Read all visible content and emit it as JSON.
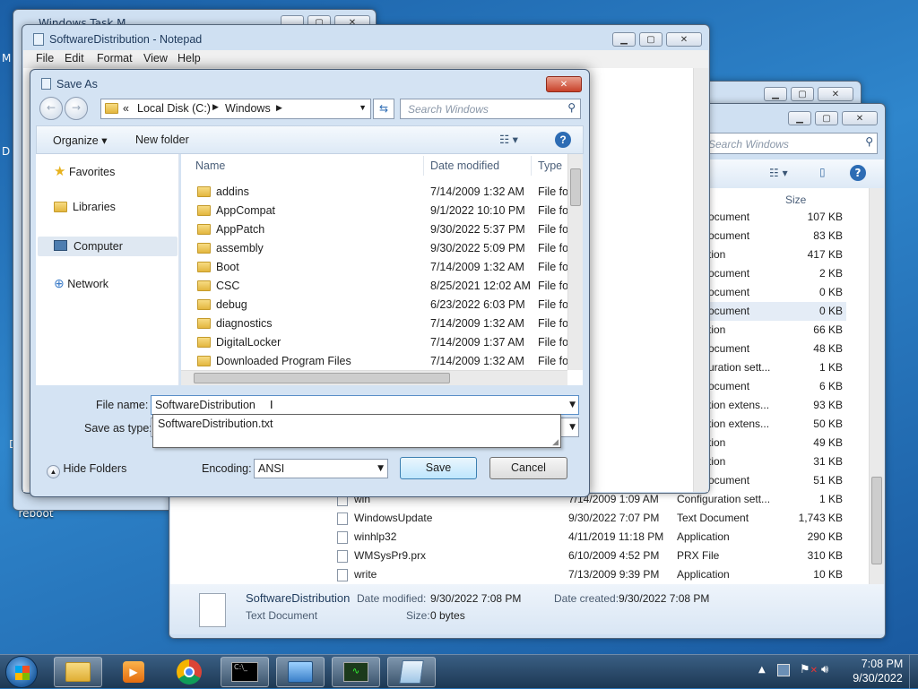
{
  "desktop": {
    "icons": [
      {
        "label": "reboot"
      }
    ],
    "edge_fragments": [
      "M",
      "D",
      "P",
      "N",
      "Do"
    ]
  },
  "bg_window_top": {
    "title": "Windows Task M"
  },
  "explorer": {
    "search_placeholder": "Search Windows",
    "columns": {
      "size": "Size"
    },
    "rows": [
      {
        "type": "ocument",
        "size": "107 KB"
      },
      {
        "type": "ocument",
        "size": "83 KB"
      },
      {
        "type": "tion",
        "size": "417 KB"
      },
      {
        "type": "ocument",
        "size": "2 KB"
      },
      {
        "type": "ocument",
        "size": "0 KB"
      },
      {
        "type": "ocument",
        "size": "0 KB"
      },
      {
        "type": "tion",
        "size": "66 KB"
      },
      {
        "type": "ocument",
        "size": "48 KB"
      },
      {
        "type": "uration sett...",
        "size": "1 KB"
      },
      {
        "type": "ocument",
        "size": "6 KB"
      },
      {
        "type": "tion extens...",
        "size": "93 KB"
      },
      {
        "type": "tion extens...",
        "size": "50 KB"
      },
      {
        "type": "tion",
        "size": "49 KB"
      },
      {
        "type": "tion",
        "size": "31 KB"
      },
      {
        "type": "ocument",
        "size": "51 KB"
      }
    ],
    "full_rows": [
      {
        "name": "win",
        "date": "7/14/2009 1:09 AM",
        "type": "Configuration sett...",
        "size": "1 KB"
      },
      {
        "name": "WindowsUpdate",
        "date": "9/30/2022 7:07 PM",
        "type": "Text Document",
        "size": "1,743 KB"
      },
      {
        "name": "winhlp32",
        "date": "4/11/2019 11:18 PM",
        "type": "Application",
        "size": "290 KB"
      },
      {
        "name": "WMSysPr9.prx",
        "date": "6/10/2009 4:52 PM",
        "type": "PRX File",
        "size": "310 KB"
      },
      {
        "name": "write",
        "date": "7/13/2009 9:39 PM",
        "type": "Application",
        "size": "10 KB"
      }
    ],
    "details": {
      "name": "SoftwareDistribution",
      "modified_label": "Date modified:",
      "modified": "9/30/2022 7:08 PM",
      "created_label": "Date created:",
      "created": "9/30/2022 7:08 PM",
      "type": "Text Document",
      "size_label": "Size:",
      "size": "0 bytes"
    }
  },
  "notepad": {
    "title": "SoftwareDistribution - Notepad",
    "menu": [
      "File",
      "Edit",
      "Format",
      "View",
      "Help"
    ]
  },
  "save_dialog": {
    "title": "Save As",
    "address": {
      "chevrons": "«",
      "parts": [
        "Local Disk (C:)",
        "Windows"
      ]
    },
    "search_placeholder": "Search Windows",
    "organize": "Organize",
    "new_folder": "New folder",
    "nav": [
      {
        "label": "Favorites",
        "icon": "star-icon"
      },
      {
        "label": "Libraries",
        "icon": "libraries-icon"
      },
      {
        "label": "Computer",
        "icon": "computer-icon"
      },
      {
        "label": "Network",
        "icon": "network-icon"
      }
    ],
    "columns": {
      "name": "Name",
      "date": "Date modified",
      "type": "Type"
    },
    "files": [
      {
        "name": "addins",
        "date": "7/14/2009 1:32 AM",
        "type": "File fol"
      },
      {
        "name": "AppCompat",
        "date": "9/1/2022 10:10 PM",
        "type": "File fol"
      },
      {
        "name": "AppPatch",
        "date": "9/30/2022 5:37 PM",
        "type": "File fol"
      },
      {
        "name": "assembly",
        "date": "9/30/2022 5:09 PM",
        "type": "File fol"
      },
      {
        "name": "Boot",
        "date": "7/14/2009 1:32 AM",
        "type": "File fol"
      },
      {
        "name": "CSC",
        "date": "8/25/2021 12:02 AM",
        "type": "File fol"
      },
      {
        "name": "debug",
        "date": "6/23/2022 6:03 PM",
        "type": "File fol"
      },
      {
        "name": "diagnostics",
        "date": "7/14/2009 1:32 AM",
        "type": "File fol"
      },
      {
        "name": "DigitalLocker",
        "date": "7/14/2009 1:37 AM",
        "type": "File fol"
      },
      {
        "name": "Downloaded Program Files",
        "date": "7/14/2009 1:32 AM",
        "type": "File fol"
      }
    ],
    "file_name_label": "File name:",
    "file_name_value": "SoftwareDistribution",
    "save_type_label": "Save as type:",
    "suggestion": "SoftwareDistribution.txt",
    "hide_folders": "Hide Folders",
    "encoding_label": "Encoding:",
    "encoding_value": "ANSI",
    "save": "Save",
    "cancel": "Cancel"
  },
  "taskbar": {
    "time": "7:08 PM",
    "date": "9/30/2022"
  },
  "colors": {
    "accent": "#3c7fb1",
    "desktop": "#2a74b5",
    "close_red": "#c8412a"
  }
}
